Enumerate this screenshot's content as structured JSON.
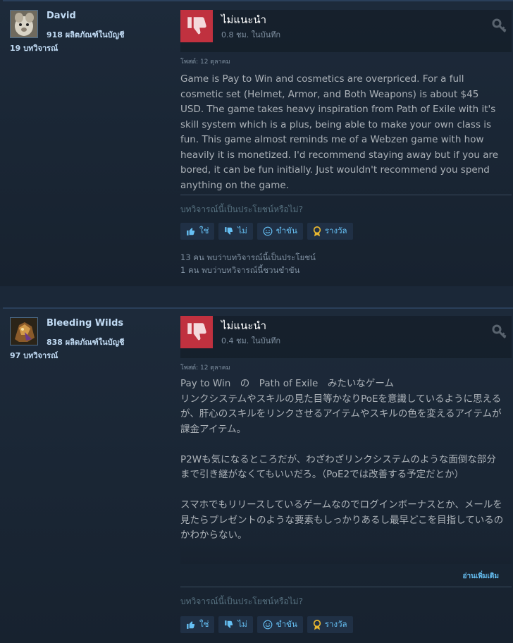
{
  "colors": {
    "accent": "#66c0f4",
    "not_recommended": "#c0313f",
    "page_bg": "#1b2838"
  },
  "reviews": [
    {
      "author": {
        "name": "David",
        "products": "918 ผลิตภัณฑ์ในบัญชี",
        "review_count": "19 บทวิจารณ์"
      },
      "verdict": "ไม่แนะนำ",
      "hours": "0.8 ชม. ในบันทึก",
      "posted": "โพสต์: 12 ตุลาคม",
      "body": "Game is Pay to Win and cosmetics are overpriced. For a full cosmetic set (Helmet, Armor, and Both Weapons) is about $45 USD. The game takes heavy inspiration from Path of Exile with it's skill system which is a plus, being able to make your own class is fun. This game almost reminds me of a Webzen game with how heavily it is monetized. I'd recommend staying away but if you are bored, it can be fun initially. Just wouldn't recommend you spend anything on the game.",
      "helpful_question": "บทวิจารณ์นี้เป็นประโยชน์หรือไม่?",
      "buttons": {
        "yes": "ใช่",
        "no": "ไม่",
        "funny": "ขำขัน",
        "award": "รางวัล"
      },
      "stats": [
        "13 คน พบว่าบทวิจารณ์นี้เป็นประโยชน์",
        "1 คน พบว่าบทวิจารณ์นี้ชวนขำขัน"
      ]
    },
    {
      "author": {
        "name": "Bleeding Wilds",
        "products": "838 ผลิตภัณฑ์ในบัญชี",
        "review_count": "97 บทวิจารณ์"
      },
      "verdict": "ไม่แนะนำ",
      "hours": "0.4 ชม. ในบันทึก",
      "posted": "โพสต์: 12 ตุลาคม",
      "body": "Pay to Win　の　Path of Exile　みたいなゲーム\nリンクシステムやスキルの見た目等かなりPoEを意識しているように思えるが、肝心のスキルをリンクさせるアイテムやスキルの色を変えるアイテムが課金アイテム。\n\nP2Wも気になるところだが、わざわざリンクシステムのような面倒な部分まで引き継がなくてもいいだろ。（PoE2では改善する予定だとか）\n\nスマホでもリリースしているゲームなのでログインボーナスとか、メールを見たらプレゼントのような要素もしっかりあるし最早どこを目指しているのかわからない。",
      "read_more": "อ่านเพิ่มเติม",
      "helpful_question": "บทวิจารณ์นี้เป็นประโยชน์หรือไม่?",
      "buttons": {
        "yes": "ใช่",
        "no": "ไม่",
        "funny": "ขำขัน",
        "award": "รางวัล"
      }
    }
  ]
}
